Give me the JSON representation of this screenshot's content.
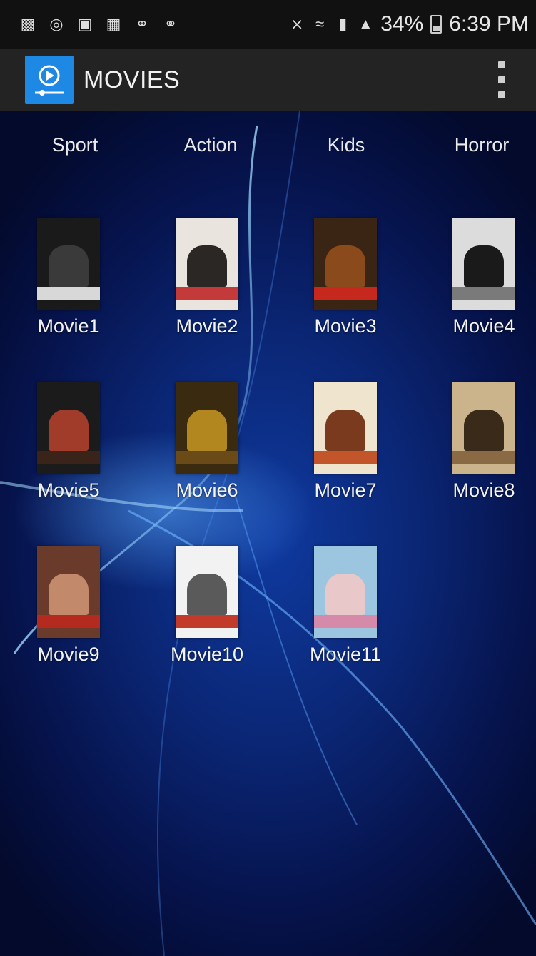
{
  "status_bar": {
    "left_icons": [
      "chat-icon",
      "sync-icon",
      "gallery-icon",
      "photo-icon",
      "saturn-icon",
      "saturn-icon-2"
    ],
    "right_icons": [
      "mute-icon",
      "wifi-icon",
      "sim-icon",
      "signal-icon"
    ],
    "battery_percent": "34%",
    "time": "6:39 PM"
  },
  "app_bar": {
    "title": "MOVIES",
    "menu_icon": "overflow-menu-icon"
  },
  "categories": [
    "Sport",
    "Action",
    "Kids",
    "Horror"
  ],
  "movies": [
    {
      "label": "Movie1",
      "colors": [
        "#1a1a1a",
        "#3a3a3a",
        "#d8d8d8"
      ]
    },
    {
      "label": "Movie2",
      "colors": [
        "#e9e4dd",
        "#2b2724",
        "#c43a3a"
      ]
    },
    {
      "label": "Movie3",
      "colors": [
        "#3a2414",
        "#8b4a1c",
        "#c7281e"
      ]
    },
    {
      "label": "Movie4",
      "colors": [
        "#dcdcdc",
        "#1a1a1a",
        "#7a7a7a"
      ]
    },
    {
      "label": "Movie5",
      "colors": [
        "#1b1b1b",
        "#a13c2a",
        "#3a2318"
      ]
    },
    {
      "label": "Movie6",
      "colors": [
        "#3a2a10",
        "#b3871f",
        "#6a4a16"
      ]
    },
    {
      "label": "Movie7",
      "colors": [
        "#efe5cf",
        "#7a3a1e",
        "#c2562a"
      ]
    },
    {
      "label": "Movie8",
      "colors": [
        "#cbb48c",
        "#3a2a1a",
        "#8a6a44"
      ]
    },
    {
      "label": "Movie9",
      "colors": [
        "#6a3a2a",
        "#c28a6a",
        "#b42a1e"
      ]
    },
    {
      "label": "Movie10",
      "colors": [
        "#f2f2f2",
        "#5a5a5a",
        "#c23a2a"
      ]
    },
    {
      "label": "Movie11",
      "colors": [
        "#9cc6e0",
        "#e8c8c8",
        "#d68aaa"
      ]
    }
  ]
}
